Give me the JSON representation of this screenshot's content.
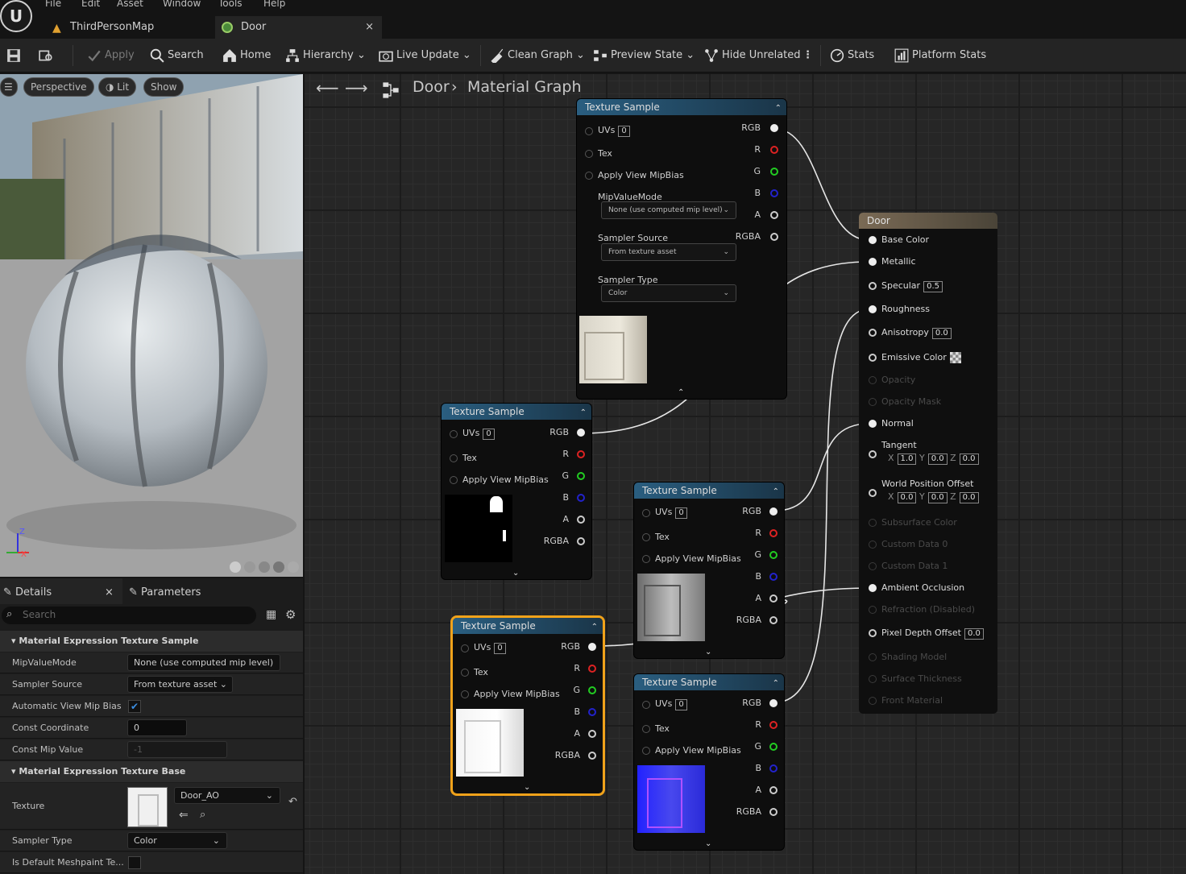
{
  "menu": [
    "File",
    "Edit",
    "Asset",
    "Window",
    "Tools",
    "Help"
  ],
  "tabs": {
    "map": "ThirdPersonMap",
    "door": "Door",
    "close": "×"
  },
  "toolbar": {
    "apply": "Apply",
    "search": "Search",
    "home": "Home",
    "hierarchy": "Hierarchy",
    "live_update": "Live Update",
    "clean_graph": "Clean Graph",
    "preview_state": "Preview State",
    "hide_unrelated": "Hide Unrelated",
    "stats": "Stats",
    "platform_stats": "Platform Stats"
  },
  "viewport": {
    "perspective": "Perspective",
    "lit": "Lit",
    "show": "Show",
    "axis_z": "Z",
    "axis_x": "X"
  },
  "details": {
    "tab_details": "Details",
    "tab_parameters": "Parameters",
    "close": "×",
    "search_placeholder": "Search",
    "cat1": "Material Expression Texture Sample",
    "mip_label": "MipValueMode",
    "mip_value": "None (use computed mip level)",
    "sampler_label": "Sampler Source",
    "sampler_value": "From texture asset",
    "auto_label": "Automatic View Mip Bias",
    "constc_label": "Const Coordinate",
    "constc_value": "0",
    "constmip_label": "Const Mip Value",
    "constmip_value": "-1",
    "cat2": "Material Expression Texture Base",
    "texture_label": "Texture",
    "texture_value": "Door_AO",
    "stype_label": "Sampler Type",
    "stype_value": "Color",
    "meshpaint_label": "Is Default Meshpaint Te..."
  },
  "graph": {
    "crumb1": "Door",
    "crumb2": "Material Graph"
  },
  "ts": {
    "title": "Texture Sample",
    "uvs": "UVs",
    "uv_val": "0",
    "tex": "Tex",
    "apply_mip": "Apply View MipBias",
    "rgb": "RGB",
    "r": "R",
    "g": "G",
    "b": "B",
    "a": "A",
    "rgba": "RGBA",
    "mipmode": "MipValueMode",
    "mipmode_val": "None (use computed mip level)",
    "samplersrc": "Sampler Source",
    "samplersrc_val": "From texture asset",
    "samplertype": "Sampler Type",
    "samplertype_val": "Color"
  },
  "door": {
    "title": "Door",
    "pins": [
      "Base Color",
      "Metallic",
      "Specular",
      "Roughness",
      "Anisotropy",
      "Emissive Color",
      "Opacity",
      "Opacity Mask",
      "Normal",
      "Tangent",
      "World Position Offset",
      "Subsurface Color",
      "Custom Data 0",
      "Custom Data 1",
      "Ambient Occlusion",
      "Refraction (Disabled)",
      "Pixel Depth Offset",
      "Shading Model",
      "Surface Thickness",
      "Front Material"
    ],
    "specular": "0.5",
    "anisotropy": "0.0",
    "pdo": "0.0",
    "tangent": {
      "x": "1.0",
      "y": "0.0",
      "z": "0.0"
    },
    "wpo": {
      "x": "0.0",
      "y": "0.0",
      "z": "0.0"
    },
    "lx": "X",
    "ly": "Y",
    "lz": "Z"
  },
  "colors": {
    "accent": "#f0a21a",
    "header": "#2a5e80"
  }
}
